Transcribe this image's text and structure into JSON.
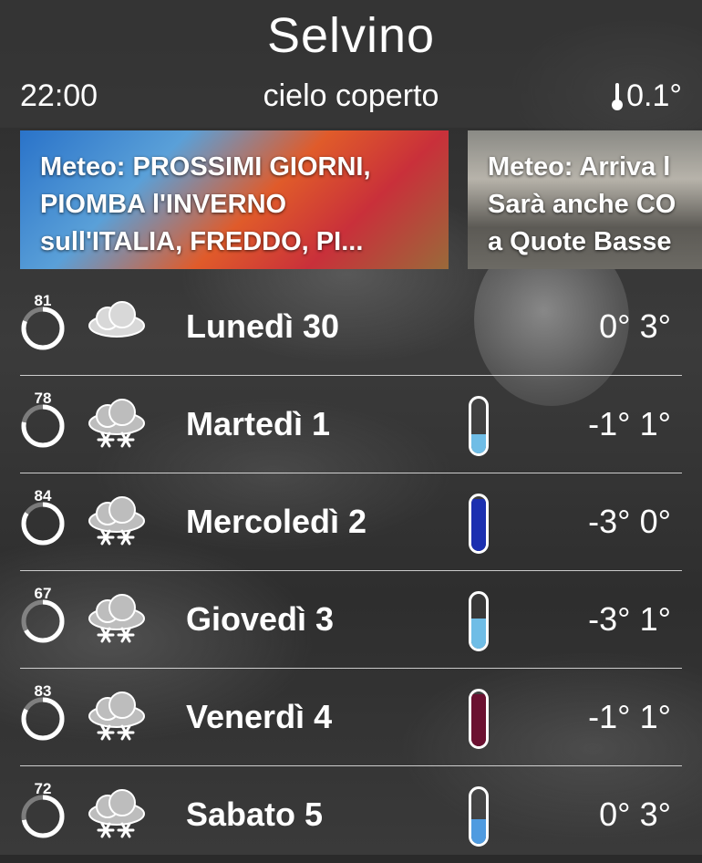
{
  "header": {
    "city": "Selvino",
    "time": "22:00",
    "condition": "cielo coperto",
    "temperature": "0.1°"
  },
  "news": [
    {
      "lines": [
        "Meteo: PROSSIMI GIORNI,",
        "PIOMBA l'INVERNO",
        "sull'ITALIA, FREDDO, PI..."
      ]
    },
    {
      "lines": [
        "Meteo: Arriva l",
        "Sarà anche CO",
        "a Quote Basse"
      ]
    }
  ],
  "days": [
    {
      "score": "81",
      "score_fraction": 0.81,
      "icon": "cloudy-icon",
      "day": "Lunedì 30",
      "temps": "0° 3°",
      "precip_fraction": null,
      "precip_color": ""
    },
    {
      "score": "78",
      "score_fraction": 0.78,
      "icon": "snow-icon",
      "day": "Martedì 1",
      "temps": "-1° 1°",
      "precip_fraction": 0.35,
      "precip_color": "#6fbde6"
    },
    {
      "score": "84",
      "score_fraction": 0.84,
      "icon": "snow-icon",
      "day": "Mercoledì 2",
      "temps": "-3° 0°",
      "precip_fraction": 0.95,
      "precip_color": "#1b2fb0"
    },
    {
      "score": "67",
      "score_fraction": 0.67,
      "icon": "snow-icon",
      "day": "Giovedì 3",
      "temps": "-3° 1°",
      "precip_fraction": 0.55,
      "precip_color": "#6fbde6"
    },
    {
      "score": "83",
      "score_fraction": 0.83,
      "icon": "snow-icon",
      "day": "Venerdì 4",
      "temps": "-1° 1°",
      "precip_fraction": 0.95,
      "precip_color": "#6b1030"
    },
    {
      "score": "72",
      "score_fraction": 0.72,
      "icon": "snow-icon",
      "day": "Sabato 5",
      "temps": "0° 3°",
      "precip_fraction": 0.45,
      "precip_color": "#4f9be0"
    }
  ]
}
